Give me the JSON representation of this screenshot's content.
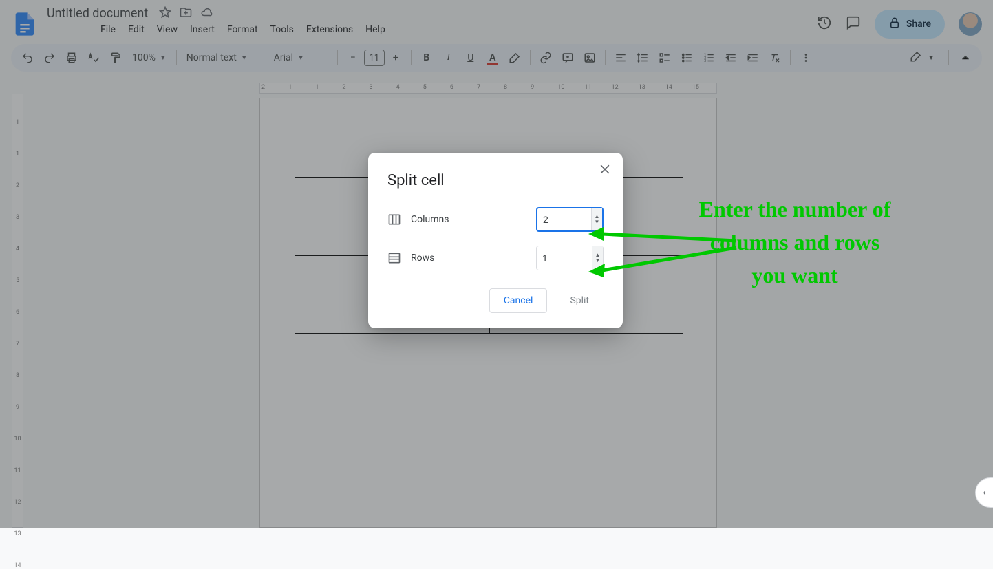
{
  "header": {
    "doc_title": "Untitled document",
    "share_label": "Share"
  },
  "menubar": [
    "File",
    "Edit",
    "View",
    "Insert",
    "Format",
    "Tools",
    "Extensions",
    "Help"
  ],
  "toolbar": {
    "zoom": "100%",
    "style": "Normal text",
    "font": "Arial",
    "font_size": "11"
  },
  "ruler_h": [
    "2",
    "1",
    "1",
    "2",
    "3",
    "4",
    "5",
    "6",
    "7",
    "8",
    "9",
    "10",
    "11",
    "12",
    "13",
    "14",
    "15"
  ],
  "ruler_v": [
    "1",
    "1",
    "2",
    "3",
    "4",
    "5",
    "6",
    "7",
    "8",
    "9",
    "10",
    "11",
    "12",
    "13",
    "14"
  ],
  "dialog": {
    "title": "Split cell",
    "columns_label": "Columns",
    "columns_value": "2",
    "rows_label": "Rows",
    "rows_value": "1",
    "cancel": "Cancel",
    "split": "Split"
  },
  "annotation": {
    "text": "Enter the number of columns and rows you want"
  }
}
